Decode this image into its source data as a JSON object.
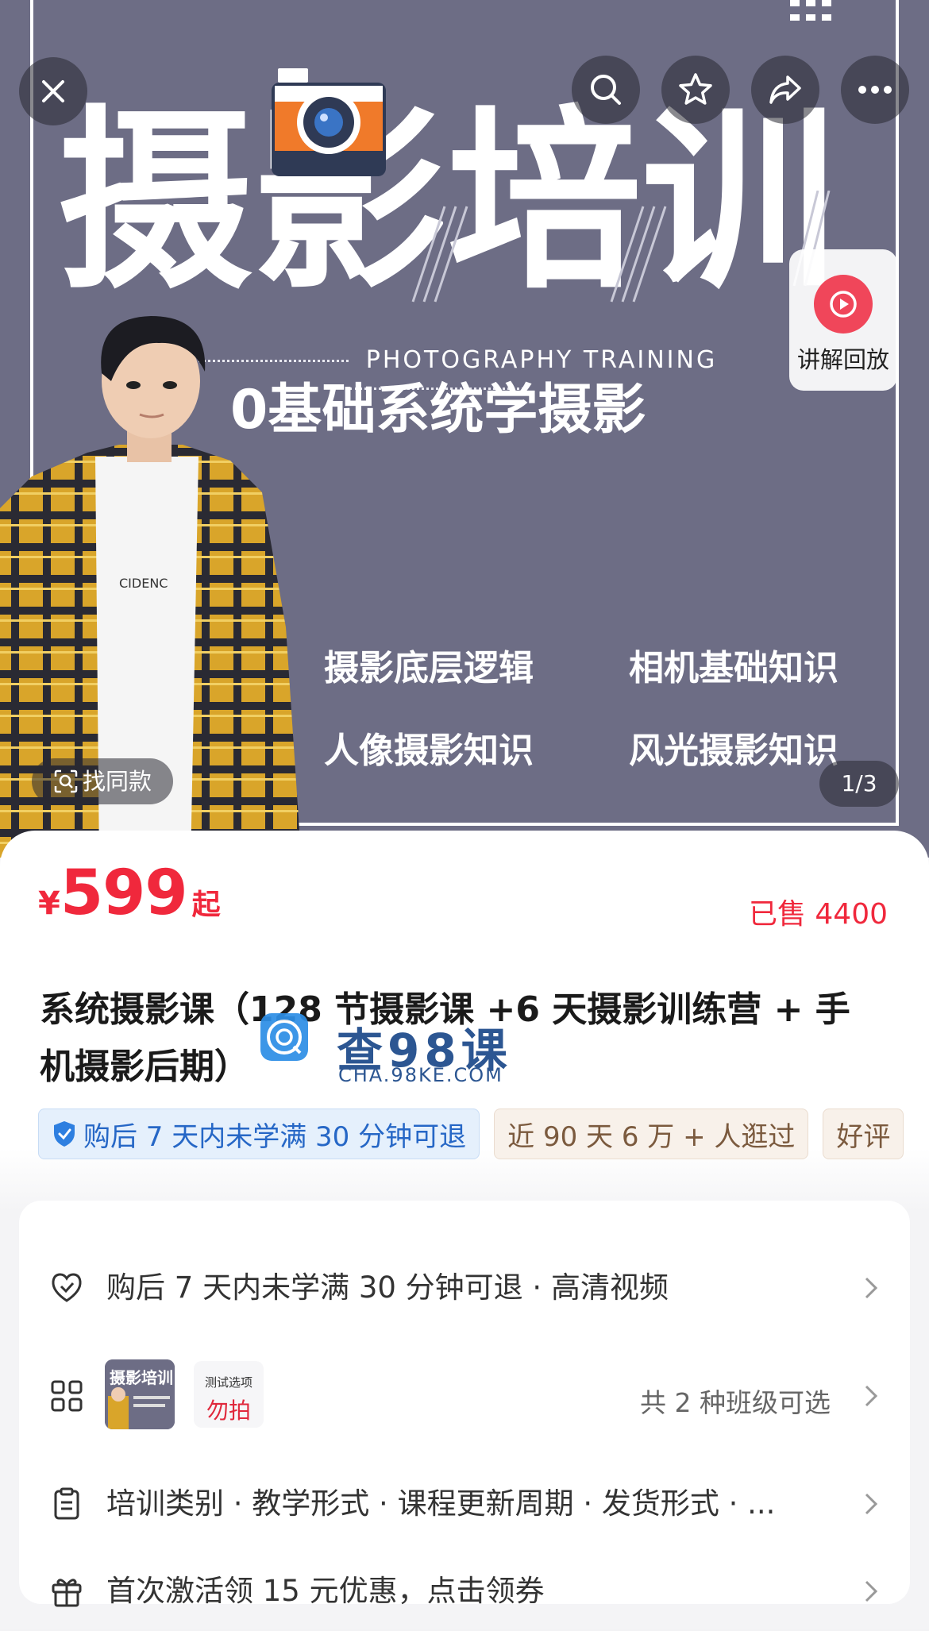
{
  "hero": {
    "title_chars": [
      "摄",
      "影",
      "培",
      "训"
    ],
    "subtitle_en": "PHOTOGRAPHY TRAINING",
    "subtitle_cn": "0基础系统学摄影",
    "features": [
      "摄影底层逻辑",
      "相机基础知识",
      "人像摄影知识",
      "风光摄影知识"
    ],
    "shirt_text": "CIDENC",
    "background_color": "#6d6d85"
  },
  "overlay": {
    "close_icon": "close-icon",
    "search_icon": "search-icon",
    "favorite_icon": "star-icon",
    "share_icon": "share-icon",
    "more_icon": "more-icon",
    "replay_label": "讲解回放",
    "find_same_label": "找同款",
    "image_counter": "1/3"
  },
  "product": {
    "currency": "¥",
    "price": "599",
    "price_suffix": "起",
    "sold": "已售 4400",
    "title": "系统摄影课（128 节摄影课 +6 天摄影训练营 + 手机摄影后期）",
    "accent_color": "#f0283c"
  },
  "watermark": {
    "text": "查98课",
    "sub": "CHA.98KE.COM"
  },
  "tags": [
    {
      "label": "购后 7 天内未学满 30 分钟可退",
      "style": "blue",
      "icon": "shield-check-icon"
    },
    {
      "label": "近 90 天 6 万 + 人逛过",
      "style": "tan"
    },
    {
      "label": "好评",
      "style": "tan"
    }
  ],
  "details": {
    "guarantee": "购后 7 天内未学满 30 分钟可退 · 高清视频",
    "option_caption": "测试选项",
    "option_value": "勿拍",
    "classes": "共 2 种班级可选",
    "specs": "培训类别 · 教学形式 · 课程更新周期 · 发货形式 · ...",
    "coupon": "首次激活领 15 元优惠，点击领券"
  }
}
